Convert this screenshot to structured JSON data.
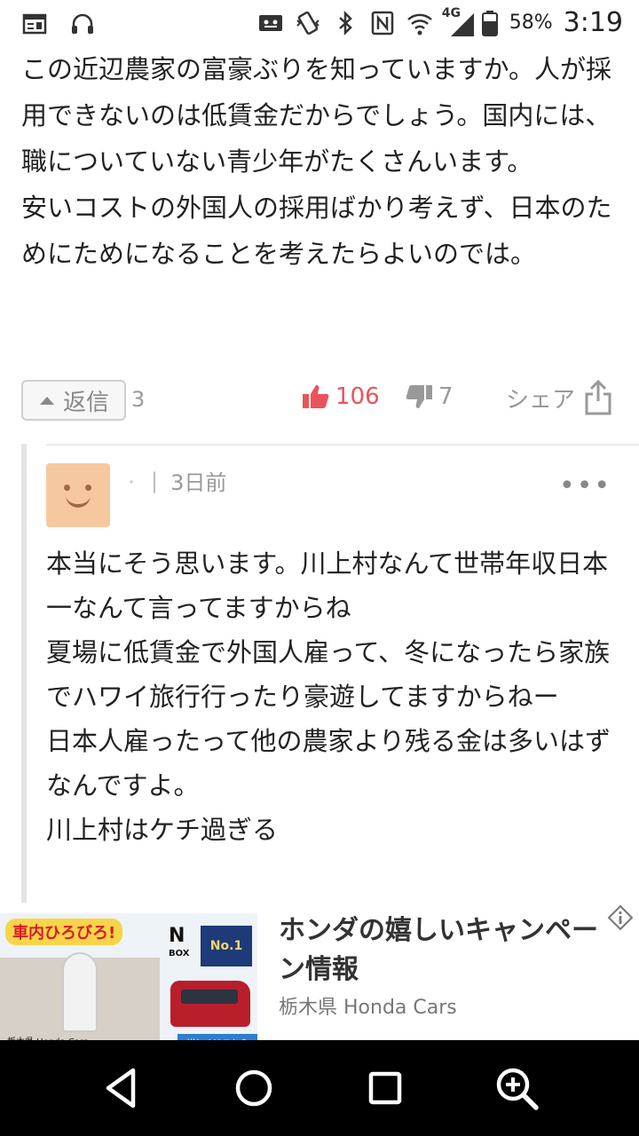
{
  "status_bar": {
    "battery_percent": "58%",
    "time": "3:19",
    "network": "4G",
    "icons": [
      "news-icon",
      "headphones-icon",
      "cast-icon",
      "vibrate-icon",
      "bluetooth-icon",
      "nfc-icon",
      "wifi-icon",
      "signal-icon",
      "battery-icon"
    ]
  },
  "comment": {
    "text": "この近辺農家の富豪ぶりを知っていますか。人が採用できないのは低賃金だからでしょう。国内には、職についていない青少年がたくさんいます。\n安いコストの外国人の採用ばかり考えず、日本のためにためになることを考えたらよいのでは。",
    "reply_label": "返信",
    "reply_count": "3",
    "likes": "106",
    "dislikes": "7",
    "share_label": "シェア"
  },
  "reply": {
    "username": "・",
    "separator": "|",
    "time_ago": "3日前",
    "more_label": "•••",
    "text": "本当にそう思います。川上村なんて世帯年収日本一なんて言ってますからね\n夏場に低賃金で外国人雇って、冬になったら家族でハワイ旅行行ったり豪遊してますからねー\n日本人雇ったって他の農家より残る金は多いはずなんですよ。\n川上村はケチ過ぎる"
  },
  "ad": {
    "title": "ホンダの嬉しいキャンペーン情報",
    "advertiser": "栃木県 Honda Cars",
    "image_badge": "車内ひろびろ!",
    "image_brand": "N",
    "image_brand_sub": "BOX",
    "image_award": "No.1",
    "image_dealer": "栃木県 Honda Cars",
    "image_cta": "詳しくはこちら"
  },
  "nav": {
    "icons": [
      "back-icon",
      "home-icon",
      "recents-icon",
      "zoom-icon"
    ]
  },
  "colors": {
    "like": "#e9545a",
    "muted": "#999999",
    "navbar": "#000000",
    "avatar": "#f6c8a0"
  }
}
